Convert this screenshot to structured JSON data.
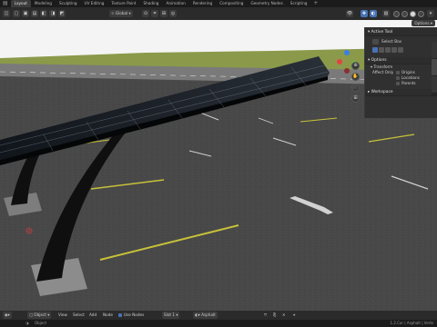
{
  "workspace_tabs": [
    {
      "label": "Layout"
    },
    {
      "label": "Modeling"
    },
    {
      "label": "Sculpting"
    },
    {
      "label": "UV Editing"
    },
    {
      "label": "Texture Paint"
    },
    {
      "label": "Shading"
    },
    {
      "label": "Animation"
    },
    {
      "label": "Rendering"
    },
    {
      "label": "Compositing"
    },
    {
      "label": "Geometry Nodes"
    },
    {
      "label": "Scripting"
    }
  ],
  "active_tab_index": 0,
  "header": {
    "transform_orientation": "Global",
    "options_label": "Options"
  },
  "npanel": {
    "active_tool_title": "Active Tool",
    "tool_name": "Select Box",
    "options_title": "Options",
    "transform_title": "Transform",
    "affect_only_label": "Affect Only",
    "affect_items": [
      "Origins",
      "Locations",
      "Parents"
    ],
    "workspace_title": "Workspace",
    "side_tabs": [
      "Item",
      "Tool",
      "View"
    ]
  },
  "bottom": {
    "mode": "Object",
    "menus": [
      "View",
      "Select",
      "Add",
      "Node"
    ],
    "use_nodes_label": "Use Nodes",
    "slot": "Slot 1",
    "material": "Asphalt"
  },
  "status": {
    "left": "Object",
    "right": "1.2.Cor | Asphalt | Verts"
  },
  "colors": {
    "accent": "#4772b3",
    "sky": "#f4f4f4",
    "grass": "#8a9a4a",
    "asphalt": "#4a4a4a",
    "stripe": "#c8c23a",
    "solar": "#1a1f2a"
  }
}
